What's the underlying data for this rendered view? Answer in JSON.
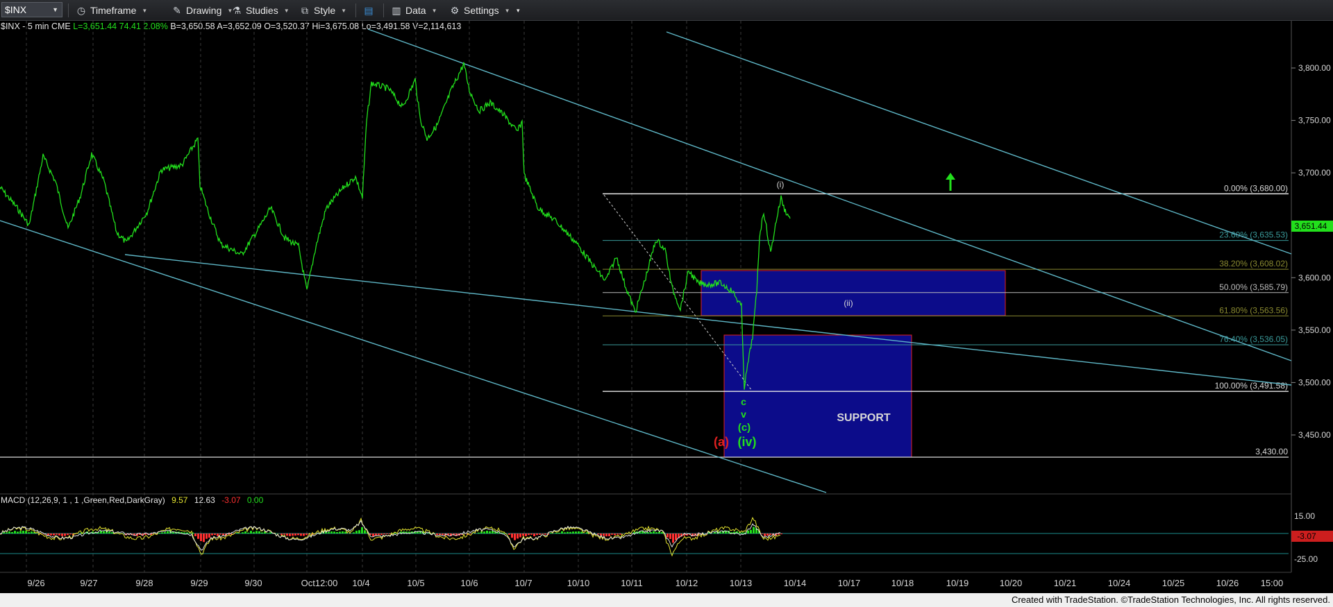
{
  "toolbar": {
    "symbol": "$INX",
    "timeframe": "Timeframe",
    "drawing": "Drawing",
    "studies": "Studies",
    "style": "Style",
    "data": "Data",
    "settings": "Settings"
  },
  "header": {
    "title": "$INX - 5 min",
    "exchange": "CME",
    "last": "L=3,651.44",
    "change": "74.41",
    "pct": "2.08%",
    "bid": "B=3,650.58",
    "ask": "A=3,652.09",
    "open": "O=3,520.37",
    "high": "Hi=3,675.08",
    "low": "Lo=3,491.58",
    "volume": "V=2,114,613"
  },
  "price_axis": {
    "ticks": [
      "3,800.00",
      "3,750.00",
      "3,700.00",
      "3,650.00",
      "3,600.00",
      "3,550.00",
      "3,500.00",
      "3,450.00"
    ],
    "last_price": "3,651.44"
  },
  "date_axis": {
    "labels": [
      "9/26",
      "9/27",
      "9/28",
      "9/29",
      "9/30",
      "Oct12:00",
      "10/4",
      "10/5",
      "10/6",
      "10/7",
      "10/10",
      "10/11",
      "10/12",
      "10/13",
      "10/14",
      "10/17",
      "10/18",
      "10/19",
      "10/20",
      "10/21",
      "10/24",
      "10/25",
      "10/26",
      "15:00"
    ]
  },
  "fib_levels": [
    {
      "label": "0.00% (3,680.00)",
      "price": 3680.0,
      "color": "#e8e8e8"
    },
    {
      "label": "23.60% (3,635.53)",
      "price": 3635.53,
      "color": "#3a9a9a"
    },
    {
      "label": "38.20% (3,608.02)",
      "price": 3608.02,
      "color": "#8a8a30"
    },
    {
      "label": "50.00% (3,585.79)",
      "price": 3585.79,
      "color": "#bbbbbb"
    },
    {
      "label": "61.80% (3,563.56)",
      "price": 3563.56,
      "color": "#8a8a30"
    },
    {
      "label": "76.40% (3,536.05)",
      "price": 3536.05,
      "color": "#3a9a9a"
    },
    {
      "label": "100.00% (3,491.58)",
      "price": 3491.58,
      "color": "#e8e8e8"
    }
  ],
  "support_line": {
    "label": "3,430.00",
    "price": 3430.0
  },
  "annotations": {
    "wave_i": "(i)",
    "wave_ii": "(ii)",
    "wave_c_small": "c",
    "wave_v": "v",
    "wave_c": "(c)",
    "wave_a": "(a)",
    "wave_iv": "(iv)",
    "support": "SUPPORT"
  },
  "macd": {
    "label": "MACD (12,26,9, 1 , 1 ,Green,Red,DarkGray)",
    "v1": "9.57",
    "v2": "12.63",
    "v3": "-3.07",
    "v4": "0.00",
    "ticks": [
      "15.00",
      "-25.00"
    ],
    "last": "-3.07"
  },
  "footer": {
    "credit": "Created with TradeStation. ©TradeStation Technologies, Inc. All rights reserved."
  },
  "colors": {
    "price_line": "#22e01c",
    "channel": "#5fb8c8",
    "box_fill": "#0c0c8a",
    "box_border": "#e02020",
    "up_arrow": "#22e01c"
  }
}
